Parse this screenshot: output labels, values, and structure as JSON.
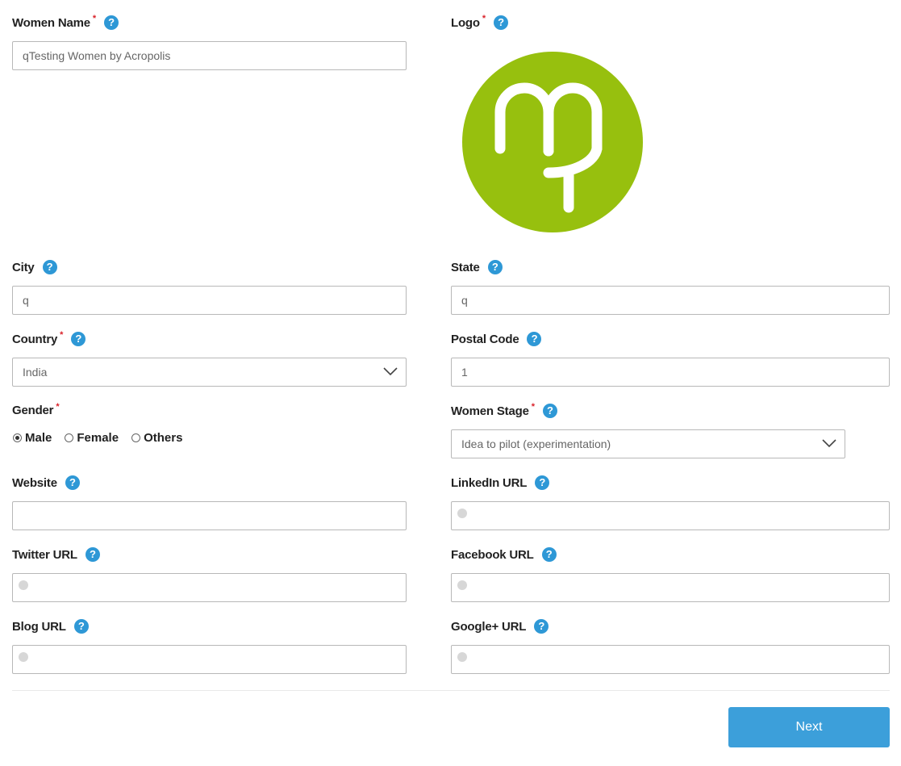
{
  "fields": {
    "women_name": {
      "label": "Women Name",
      "required": "*",
      "value": "qTesting Women by Acropolis"
    },
    "logo": {
      "label": "Logo",
      "required": "*"
    },
    "city": {
      "label": "City",
      "value": "q"
    },
    "state": {
      "label": "State",
      "value": "q"
    },
    "country": {
      "label": "Country",
      "required": "*",
      "value": "India"
    },
    "postal_code": {
      "label": "Postal Code",
      "value": "1"
    },
    "gender": {
      "label": "Gender",
      "required": "*",
      "options": [
        "Male",
        "Female",
        "Others"
      ],
      "selected": "Male"
    },
    "women_stage": {
      "label": "Women Stage",
      "required": "*",
      "value": "Idea to pilot (experimentation)"
    },
    "website": {
      "label": "Website",
      "value": ""
    },
    "linkedin": {
      "label": "LinkedIn URL",
      "value": ""
    },
    "twitter": {
      "label": "Twitter URL",
      "value": ""
    },
    "facebook": {
      "label": "Facebook URL",
      "value": ""
    },
    "blog": {
      "label": "Blog URL",
      "value": ""
    },
    "googleplus": {
      "label": "Google+ URL",
      "value": ""
    }
  },
  "help_glyph": "?",
  "next_label": "Next",
  "colors": {
    "accent": "#3c9fda",
    "help": "#2e98d6",
    "logo_green": "#97c00e",
    "required": "#d9222a"
  }
}
